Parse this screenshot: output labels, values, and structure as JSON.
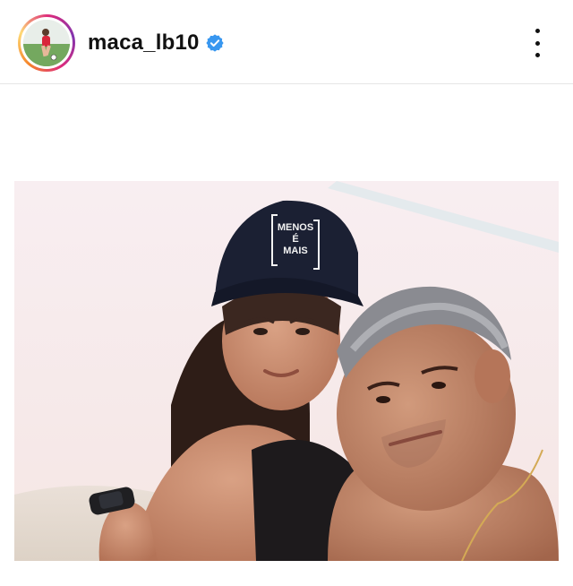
{
  "post": {
    "username": "maca_lb10",
    "verified": true,
    "avatar_icon": "profile-photo-soccer-player",
    "verified_icon": "verified-badge-icon",
    "more_icon": "more-vertical-icon",
    "photo": {
      "description_icon": "post-photo",
      "cap_text_line1": "MENOS",
      "cap_text_line2": "É",
      "cap_text_line3": "MAIS"
    }
  },
  "colors": {
    "verified_blue": "#3897f0",
    "text": "#111111",
    "divider": "#e6e6e6"
  }
}
